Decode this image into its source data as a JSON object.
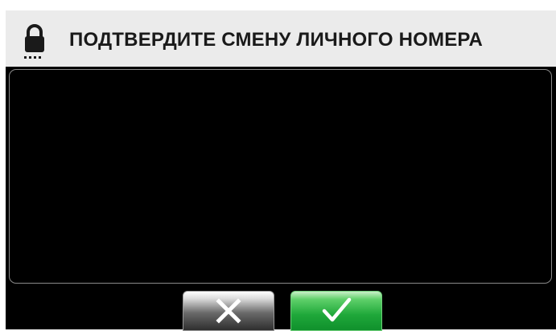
{
  "dialog": {
    "title": "ПОДТВЕРДИТЕ СМЕНУ ЛИЧНОГО НОМЕРА",
    "header_icon": "lock-icon",
    "cancel_icon": "close-icon",
    "confirm_icon": "check-icon"
  },
  "colors": {
    "header_background": "#ebebeb",
    "screen_background": "#000000",
    "confirm_green": "#1fa83a",
    "cancel_gray": "#4a4a4a"
  }
}
